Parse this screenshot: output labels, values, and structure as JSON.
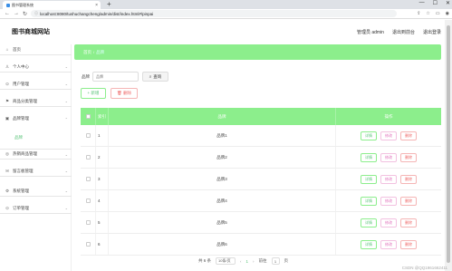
{
  "browser": {
    "tab_title": "图书管理系统",
    "tab_close": "×",
    "new_tab": "+",
    "url": "localhost:8080/tushuchangcheng/admin/dist/index.html#/pinpai",
    "url_lock": "ⓘ",
    "controls": [
      "—",
      "☐",
      "✕"
    ]
  },
  "header": {
    "title": "图书商城网站",
    "user": "管理员 admin",
    "front": "退出到前台",
    "logout": "退出登录"
  },
  "sidebar": {
    "items": [
      {
        "icon": "home-icon",
        "glyph": "⌂",
        "label": "首页",
        "chev": ""
      },
      {
        "icon": "user-icon",
        "glyph": "♙",
        "label": "个人中心",
        "chev": "⌄"
      },
      {
        "icon": "users-icon",
        "glyph": "⊙",
        "label": "用户管理",
        "chev": "⌄"
      },
      {
        "icon": "category-icon",
        "glyph": "⚑",
        "label": "商品分类管理",
        "chev": "⌄"
      },
      {
        "icon": "brand-icon",
        "glyph": "▣",
        "label": "品牌管理",
        "chev": "⌃"
      },
      {
        "icon": "hot-icon",
        "glyph": "◎",
        "label": "热销商品管理",
        "chev": "⌄"
      },
      {
        "icon": "message-icon",
        "glyph": "✉",
        "label": "留言板管理",
        "chev": "⌄"
      },
      {
        "icon": "system-icon",
        "glyph": "⚙",
        "label": "系统管理",
        "chev": "⌄"
      },
      {
        "icon": "order-icon",
        "glyph": "⊙",
        "label": "订单管理",
        "chev": "⌄"
      }
    ],
    "sub_active": "品牌"
  },
  "breadcrumb": {
    "home": "首页",
    "sep": "/",
    "current": "品牌"
  },
  "search": {
    "label": "品牌",
    "placeholder": "品牌",
    "button": "查询",
    "button_icon": "⌕"
  },
  "actions": {
    "add": "+ 新增",
    "delete": "🗑 删除"
  },
  "table": {
    "headers": [
      "",
      "索引",
      "品牌",
      "操作"
    ],
    "rows": [
      {
        "index": "1",
        "brand": "品牌1"
      },
      {
        "index": "2",
        "brand": "品牌2"
      },
      {
        "index": "3",
        "brand": "品牌3"
      },
      {
        "index": "4",
        "brand": "品牌4"
      },
      {
        "index": "5",
        "brand": "品牌5"
      },
      {
        "index": "6",
        "brand": "品牌6"
      }
    ],
    "btn_detail": "详情",
    "btn_edit": "修改",
    "btn_delete": "删除"
  },
  "pager": {
    "total": "共 6 条",
    "per_page": "10条/页",
    "prev": "‹",
    "page": "1",
    "next": "›",
    "goto": "前往",
    "goto_value": "1",
    "unit": "页"
  },
  "watermark": "CSDN @QQ1961662411"
}
